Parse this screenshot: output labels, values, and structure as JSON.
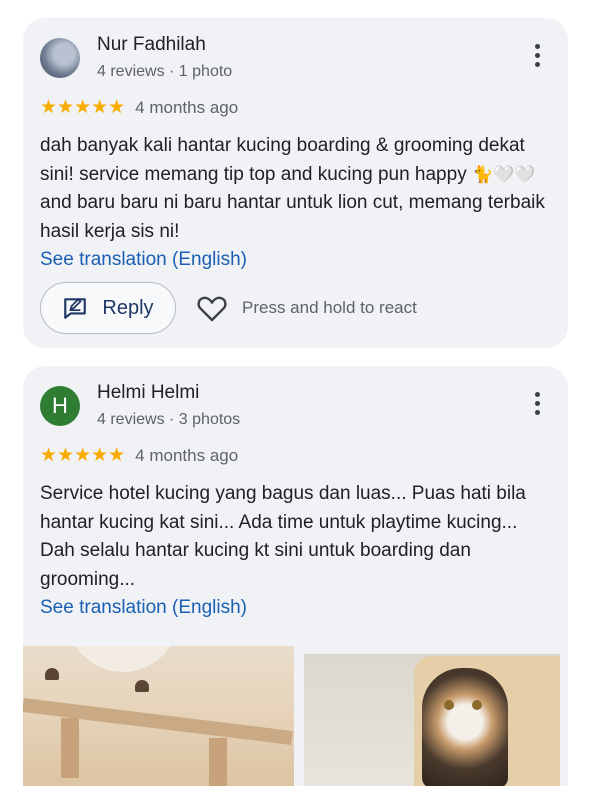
{
  "reviews": [
    {
      "name": "Nur Fadhilah",
      "avatar_type": "photo",
      "meta": "4 reviews · 1 photo",
      "rating": 5,
      "stars": "★★★★★",
      "time_ago": "4 months ago",
      "text_part1": "dah banyak kali hantar kucing boarding & grooming dekat sini! service memang tip top and kucing pun happy ",
      "emojis": "🐈🤍🤍",
      "text_part2": " and baru baru ni baru hantar untuk lion cut, memang terbaik hasil kerja sis ni!",
      "translation_link": "See translation (English)",
      "reply_label": "Reply",
      "react_label": "Press and hold to react"
    },
    {
      "name": "Helmi Helmi",
      "avatar_letter": "H",
      "avatar_color": "#2e7d32",
      "meta": "4 reviews · 3 photos",
      "rating": 5,
      "stars": "★★★★★",
      "time_ago": "4 months ago",
      "text": "Service hotel kucing yang bagus dan luas... Puas hati bila hantar kucing kat sini... Ada time untuk playtime kucing... Dah selalu hantar kucing kt sini untuk boarding dan grooming...",
      "translation_link": "See translation (English)"
    }
  ],
  "colors": {
    "card_bg": "#f0f2f5",
    "star": "#f9ab00",
    "link": "#1a5fb4",
    "reply_text": "#1f3864"
  }
}
